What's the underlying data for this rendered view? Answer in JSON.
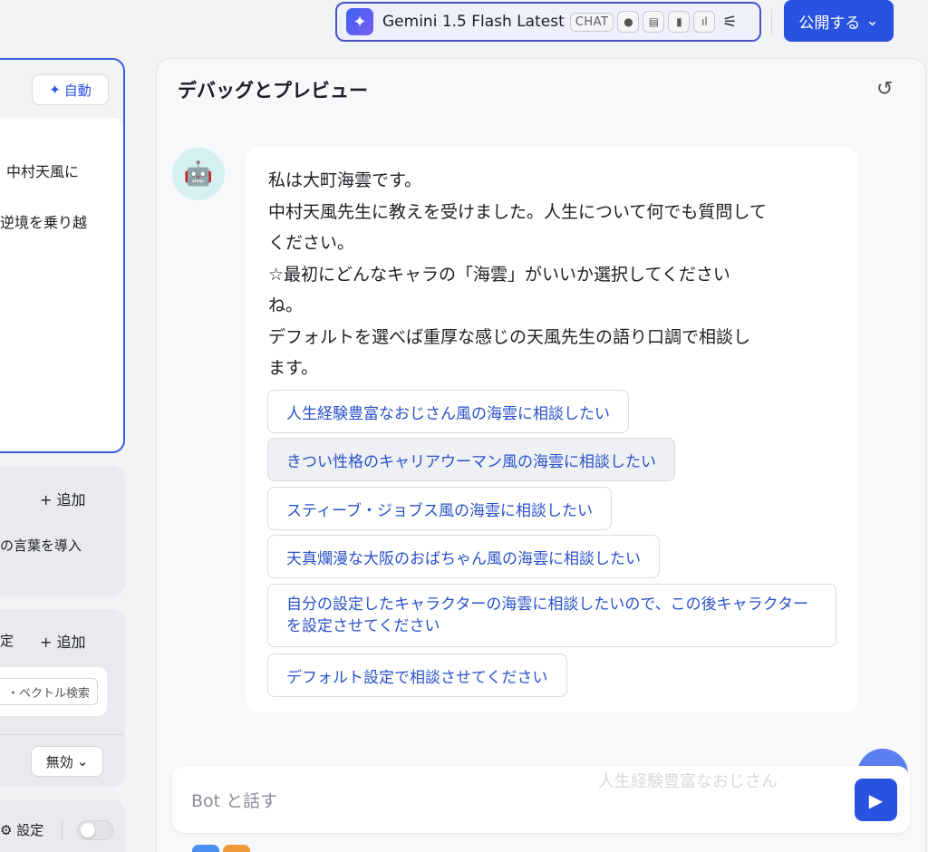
{
  "header": {
    "model_name": "Gemini 1.5 Flash Latest",
    "mode_badge": "CHAT",
    "capability_icons": [
      "eye-icon",
      "document-icon",
      "video-icon",
      "audio-icon"
    ],
    "publish_label": "公開する"
  },
  "left_panel": {
    "auto_label": "自動",
    "prompt_lines": [
      "中村天風に",
      "逆境を乗り越"
    ],
    "add_label_1": "+ 追加",
    "opening_text": "の言葉を導入",
    "section_label": "定",
    "add_label_2": "+ 追加",
    "vector_search": "・ベクトル検索",
    "disable_select": "無効",
    "settings_label": "⚙ 設定"
  },
  "preview": {
    "title": "デバッグとプレビュー",
    "message_lines": [
      "私は大町海雲です。",
      "中村天風先生に教えを受けました。人生について何でも質問して",
      "ください。",
      "☆最初にどんなキャラの「海雲」がいいか選択してください",
      "ね。",
      "デフォルトを選べば重厚な感じの天風先生の語り口調で相談し",
      "ます。"
    ],
    "options": [
      "人生経験豊富なおじさん風の海雲に相談したい",
      "きつい性格のキャリアウーマン風の海雲に相談したい",
      "スティーブ・ジョブス風の海雲に相談したい",
      "天真爛漫な大阪のおばちゃん風の海雲に相談したい",
      "自分の設定したキャラクターの海雲に相談したいので、この後キャラクターを設定させてください",
      "デフォルト設定で相談させてください"
    ],
    "input_placeholder": "Bot と話す",
    "ghost_text": "人生経験豊富なおじさん"
  },
  "colors": {
    "accent": "#2a52e0",
    "option_text": "#2a52c9",
    "avatar_bg": "#d5f0f0"
  }
}
